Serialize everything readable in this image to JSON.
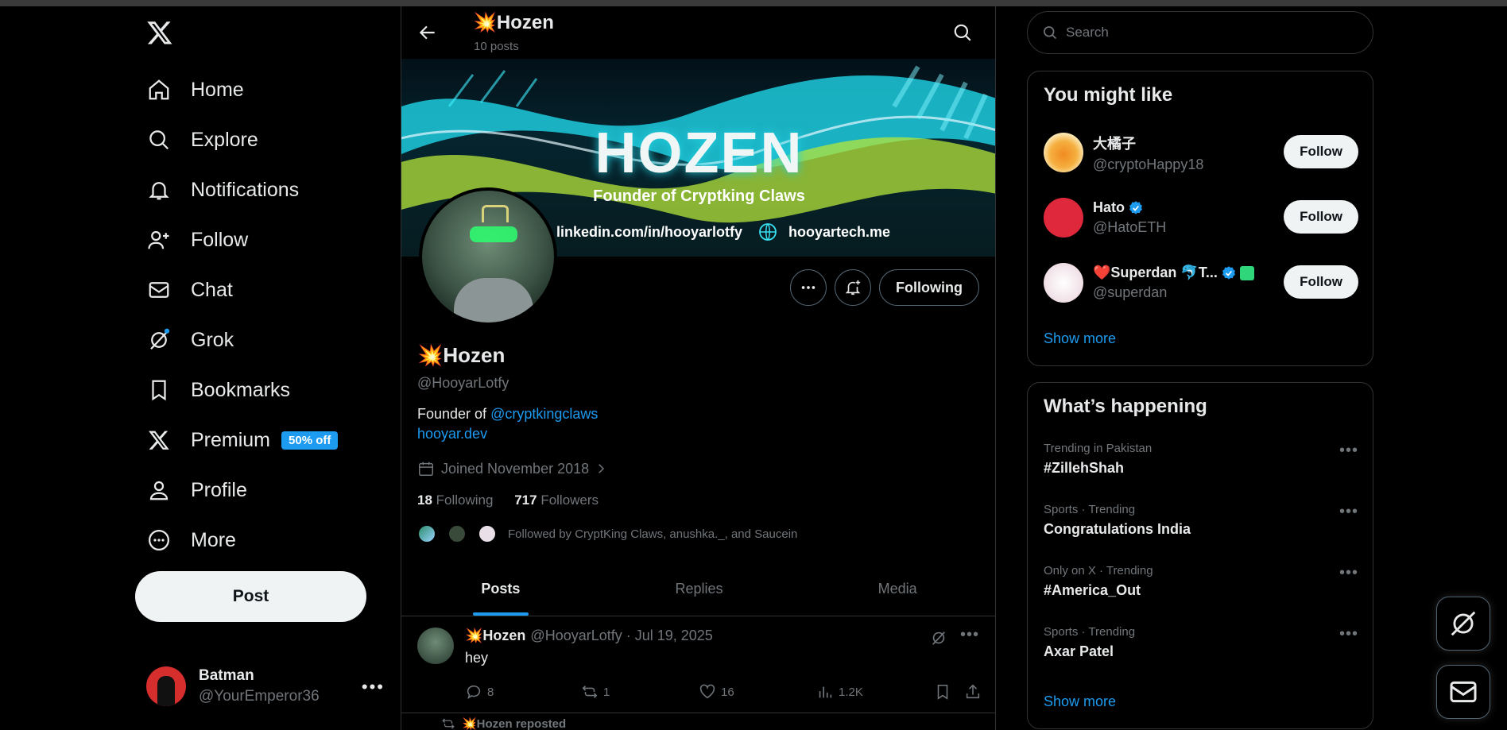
{
  "nav": {
    "items": [
      {
        "label": "Home",
        "icon": "home-icon"
      },
      {
        "label": "Explore",
        "icon": "search-icon"
      },
      {
        "label": "Notifications",
        "icon": "bell-icon"
      },
      {
        "label": "Follow",
        "icon": "person-add-icon"
      },
      {
        "label": "Chat",
        "icon": "envelope-icon"
      },
      {
        "label": "Grok",
        "icon": "grok-icon"
      },
      {
        "label": "Bookmarks",
        "icon": "bookmark-icon"
      },
      {
        "label": "Premium",
        "icon": "x-logo-icon"
      },
      {
        "label": "Profile",
        "icon": "person-icon"
      },
      {
        "label": "More",
        "icon": "more-circle-icon"
      }
    ],
    "premium_badge": "50% off",
    "post_label": "Post",
    "account": {
      "name": "Batman",
      "handle": "@YourEmperor36"
    }
  },
  "header": {
    "title": "💥Hozen",
    "subtitle": "10 posts"
  },
  "banner": {
    "title": "HOZEN",
    "subtitle": "Founder of Cryptking Claws",
    "link1": "linkedin.com/in/hooyarlotfy",
    "link2": "hooyartech.me"
  },
  "profile": {
    "name": "💥Hozen",
    "handle": "@HooyarLotfy",
    "bio_prefix": "Founder of ",
    "bio_mention": "@cryptkingclaws",
    "link": "hooyar.dev",
    "joined": "Joined November 2018",
    "following_count": "18",
    "following_label": "Following",
    "followers_count": "717",
    "followers_label": "Followers",
    "followed_by": "Followed by CryptKing Claws, anushka._, and Saucein",
    "following_button": "Following"
  },
  "tabs": [
    "Posts",
    "Replies",
    "Media"
  ],
  "tweet": {
    "name": "💥Hozen",
    "meta": "@HooyarLotfy · Jul 19, 2025",
    "text": "hey",
    "replies": "8",
    "reposts": "1",
    "likes": "16",
    "views": "1.2K"
  },
  "repost_line": "💥Hozen reposted",
  "search": {
    "placeholder": "Search"
  },
  "you_might_like": {
    "title": "You might like",
    "users": [
      {
        "name": "大橘子",
        "handle": "@cryptoHappy18",
        "color": "#f0a030",
        "verified": false
      },
      {
        "name": "Hato",
        "handle": "@HatoETH",
        "color": "#e0283c",
        "verified": true
      },
      {
        "name": "❤️Superdan 🐬T...",
        "handle": "@superdan",
        "color": "#f2e4ea",
        "verified": true
      }
    ],
    "follow_label": "Follow",
    "show_more": "Show more"
  },
  "whats_happening": {
    "title": "What’s happening",
    "trends": [
      {
        "context": "Trending in Pakistan",
        "name": "#ZillehShah"
      },
      {
        "context": "Sports · Trending",
        "name": "Congratulations India"
      },
      {
        "context": "Only on X · Trending",
        "name": "#America_Out"
      },
      {
        "context": "Sports · Trending",
        "name": "Axar Patel"
      }
    ],
    "show_more": "Show more"
  },
  "colors": {
    "accent": "#1d9bf0",
    "background": "#000000",
    "border": "#2f3336",
    "muted": "#71767b"
  }
}
